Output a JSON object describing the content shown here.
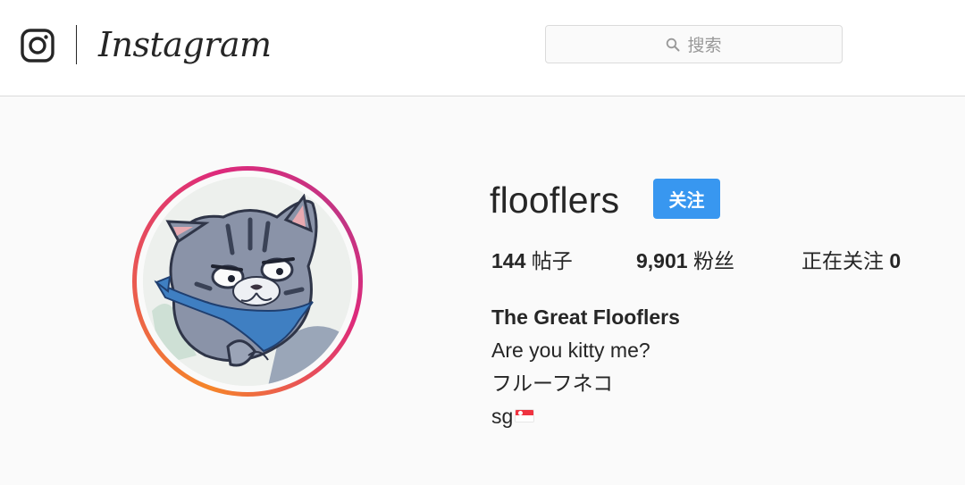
{
  "header": {
    "logo_icon": "instagram-camera-icon",
    "wordmark": "Instagram",
    "search": {
      "icon": "search-icon",
      "placeholder": "搜索"
    }
  },
  "profile": {
    "avatar": "cat-illustration-avatar",
    "username": "flooflers",
    "follow_label": "关注",
    "stats": {
      "posts_count": "144",
      "posts_label": "帖子",
      "followers_count": "9,901",
      "followers_label": "粉丝",
      "following_label": "正在关注",
      "following_count": "0"
    },
    "bio": {
      "name": "The Great Flooflers",
      "line1": "Are you kitty me?",
      "line2": "フルーフネコ",
      "line3": "sg",
      "flag": "singapore-flag-icon"
    }
  },
  "colors": {
    "follow_button": "#3897f0",
    "text": "#262626",
    "background": "#fafafa",
    "ring_start": "#f58529",
    "ring_end": "#dd2a7b"
  }
}
